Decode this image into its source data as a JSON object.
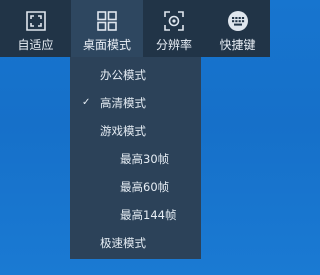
{
  "toolbar": {
    "items": [
      {
        "label": "自适应",
        "icon": "fit-screen-icon"
      },
      {
        "label": "桌面模式",
        "icon": "grid-icon"
      },
      {
        "label": "分辨率",
        "icon": "resolution-icon"
      },
      {
        "label": "快捷键",
        "icon": "keyboard-icon"
      }
    ],
    "active_index": 1
  },
  "menu": {
    "items": [
      {
        "label": "办公模式",
        "checked": false,
        "level": 0
      },
      {
        "label": "高清模式",
        "checked": true,
        "level": 0
      },
      {
        "label": "游戏模式",
        "checked": false,
        "level": 0
      },
      {
        "label": "最高30帧",
        "checked": false,
        "level": 1
      },
      {
        "label": "最高60帧",
        "checked": false,
        "level": 1
      },
      {
        "label": "最高144帧",
        "checked": false,
        "level": 1
      },
      {
        "label": "极速模式",
        "checked": false,
        "level": 0
      }
    ],
    "check_glyph": "✓"
  },
  "colors": {
    "background": "#1775cf",
    "toolbar": "#213447",
    "active_tool": "#2e4760",
    "menu": "#2c4259",
    "text": "#e6edf4"
  }
}
